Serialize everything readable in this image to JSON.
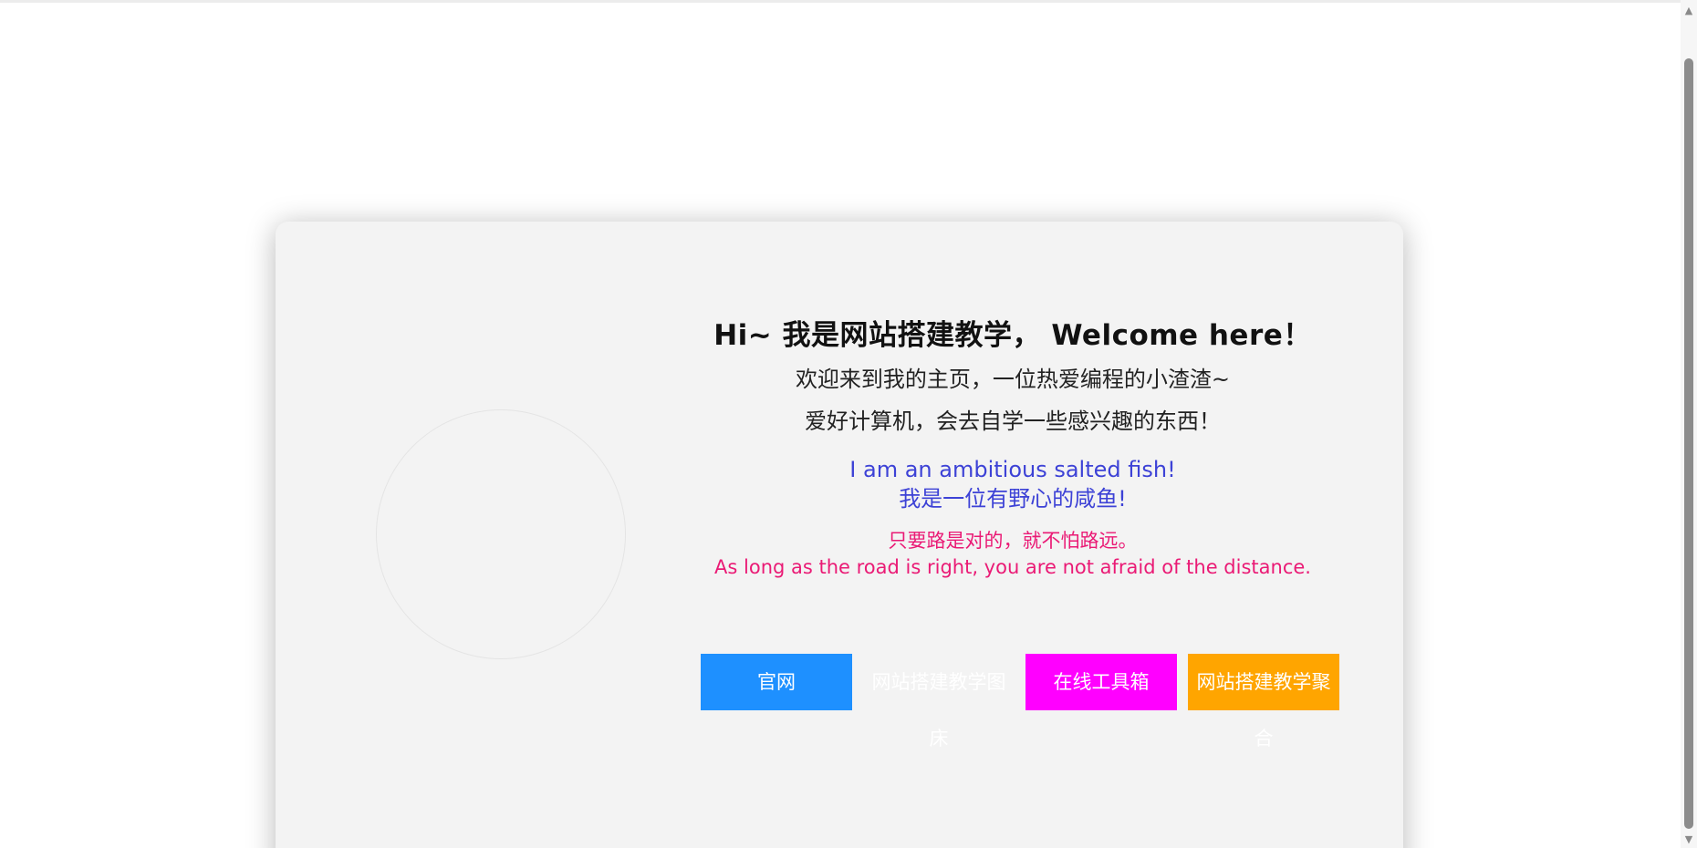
{
  "title": "Hi~ 我是网站搭建教学， Welcome here！",
  "intro": [
    "欢迎来到我的主页，一位热爱编程的小渣渣~",
    "爱好计算机，会去自学一些感兴趣的东西！"
  ],
  "motto": {
    "en": "I am an ambitious salted fish!",
    "zh": "我是一位有野心的咸鱼!"
  },
  "saying": {
    "zh": "只要路是对的，就不怕路远。",
    "en": "As long as the road is right, you are not afraid of the distance."
  },
  "buttons": [
    {
      "label": "官网",
      "color": "#1e90ff"
    },
    {
      "label": "网站搭建教学图床",
      "color": "transparent"
    },
    {
      "label": "在线工具箱",
      "color": "#ff00ff"
    },
    {
      "label": "网站搭建教学聚合",
      "color": "#ffa500"
    }
  ],
  "colors": {
    "card_bg": "#f3f3f3",
    "motto": "#3d42d6",
    "saying": "#ea1a75"
  },
  "scrollbar": {
    "up_icon": "triangle-up-icon",
    "down_icon": "triangle-down-icon"
  }
}
